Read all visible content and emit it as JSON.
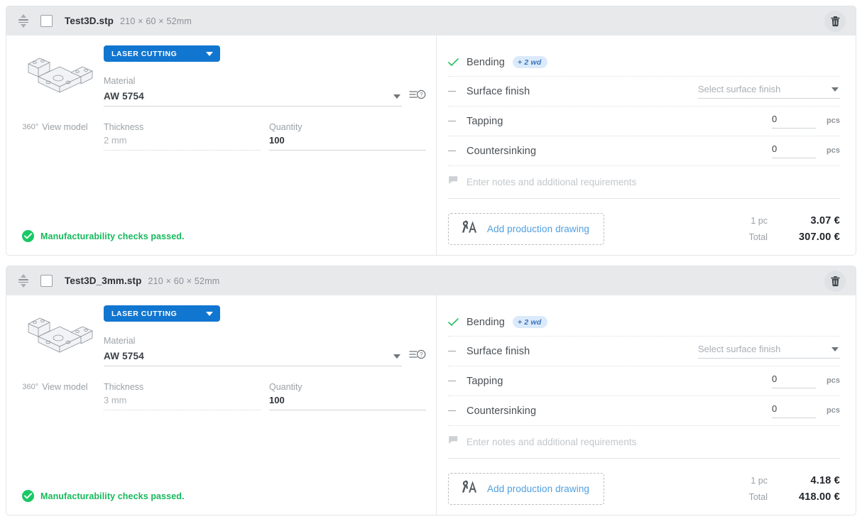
{
  "cards": [
    {
      "header": {
        "file_name": "Test3D.stp",
        "dimensions": "210 × 60 × 52mm",
        "sort_handle_name": "reorder-handle",
        "delete_label": "Delete part"
      },
      "model": {
        "view_model_label": "View model",
        "degrees_label": "360°"
      },
      "process": {
        "selected": "LASER CUTTING"
      },
      "material": {
        "label": "Material",
        "value": "AW 5754"
      },
      "thickness": {
        "label": "Thickness",
        "value": "2 mm"
      },
      "quantity": {
        "label": "Quantity",
        "value": "100"
      },
      "manufacturability": {
        "text": "Manufacturability checks passed."
      },
      "operations": [
        {
          "label": "Bending",
          "mark": "check",
          "badge": "+ 2 wd",
          "control": "none"
        },
        {
          "label": "Surface finish",
          "mark": "dash",
          "control": "select",
          "placeholder": "Select surface finish"
        },
        {
          "label": "Tapping",
          "mark": "dash",
          "control": "number",
          "value": "0",
          "unit": "pcs"
        },
        {
          "label": "Countersinking",
          "mark": "dash",
          "control": "number",
          "value": "0",
          "unit": "pcs"
        }
      ],
      "notes": {
        "placeholder": "Enter notes and additional requirements"
      },
      "drawing": {
        "label": "Add production drawing"
      },
      "pricing": {
        "unit_label": "1 pc",
        "unit_price": "3.07 €",
        "total_label": "Total",
        "total_price": "307.00 €"
      }
    },
    {
      "header": {
        "file_name": "Test3D_3mm.stp",
        "dimensions": "210 × 60 × 52mm",
        "sort_handle_name": "reorder-handle",
        "delete_label": "Delete part"
      },
      "model": {
        "view_model_label": "View model",
        "degrees_label": "360°"
      },
      "process": {
        "selected": "LASER CUTTING"
      },
      "material": {
        "label": "Material",
        "value": "AW 5754"
      },
      "thickness": {
        "label": "Thickness",
        "value": "3 mm"
      },
      "quantity": {
        "label": "Quantity",
        "value": "100"
      },
      "manufacturability": {
        "text": "Manufacturability checks passed."
      },
      "operations": [
        {
          "label": "Bending",
          "mark": "check",
          "badge": "+ 2 wd",
          "control": "none"
        },
        {
          "label": "Surface finish",
          "mark": "dash",
          "control": "select",
          "placeholder": "Select surface finish"
        },
        {
          "label": "Tapping",
          "mark": "dash",
          "control": "number",
          "value": "0",
          "unit": "pcs"
        },
        {
          "label": "Countersinking",
          "mark": "dash",
          "control": "number",
          "value": "0",
          "unit": "pcs"
        }
      ],
      "notes": {
        "placeholder": "Enter notes and additional requirements"
      },
      "drawing": {
        "label": "Add production drawing"
      },
      "pricing": {
        "unit_label": "1 pc",
        "unit_price": "4.18 €",
        "total_label": "Total",
        "total_price": "418.00 €"
      }
    }
  ],
  "colors": {
    "process_blue": "#1176d0",
    "badge_bg": "#dbeafb",
    "badge_text": "#3b73b9",
    "success_green": "#16b95b",
    "link_blue": "#4f9fe0",
    "header_grey": "#e7e9eb"
  }
}
